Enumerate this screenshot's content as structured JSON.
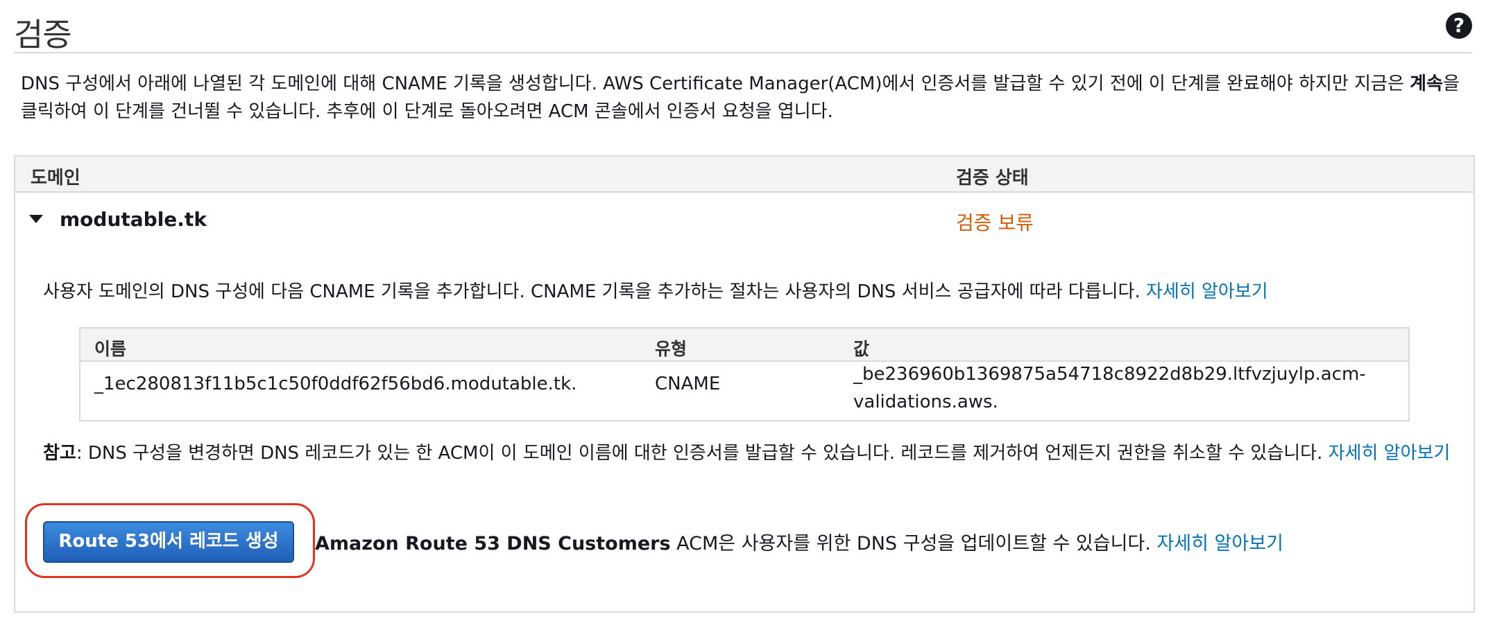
{
  "header": {
    "title": "검증",
    "help_icon": "question-circle-icon"
  },
  "intro": {
    "text_before": "DNS 구성에서 아래에 나열된 각 도메인에 대해 CNAME 기록을 생성합니다. AWS Certificate Manager(ACM)에서 인증서를 발급할 수 있기 전에 이 단계를 완료해야 하지만 지금은 ",
    "bold": "계속",
    "text_after": "을 클릭하여 이 단계를 건너뛸 수 있습니다. 추후에 이 단계로 돌아오려면 ACM 콘솔에서 인증서 요청을 엽니다."
  },
  "table": {
    "columns": {
      "domain": "도메인",
      "status": "검증 상태"
    },
    "row": {
      "domain": "modutable.tk",
      "status": "검증 보류",
      "status_color": "#d45b07",
      "instructions": "사용자 도메인의 DNS 구성에 다음 CNAME 기록을 추가합니다. CNAME 기록을 추가하는 절차는 사용자의 DNS 서비스 공급자에 따라 다릅니다. ",
      "learn_more": "자세히 알아보기",
      "record": {
        "headers": {
          "name": "이름",
          "type": "유형",
          "value": "값"
        },
        "name": "_1ec280813f11b5c1c50f0ddf62f56bd6.modutable.tk.",
        "type": "CNAME",
        "value_line1": "_be236960b1369875a54718c8922d8b29.ltfvzjuylp.acm-",
        "value_line2": "validations.aws."
      },
      "note_label": "참고",
      "note_text": ": DNS 구성을 변경하면 DNS 레코드가 있는 한 ACM이 이 도메인 이름에 대한 인증서를 발급할 수 있습니다. 레코드를 제거하여 언제든지 권한을 취소할 수 있습니다. ",
      "note_link": "자세히 알아보기",
      "route53_button": "Route 53에서 레코드 생성",
      "route53_bold": "Amazon Route 53 DNS Customers",
      "route53_text": " ACM은 사용자를 위한 DNS 구성을 업데이트할 수 있습니다. ",
      "route53_link": "자세히 알아보기"
    }
  },
  "colors": {
    "link": "#0073bb",
    "pending": "#d45b07",
    "button": "#1f5fb7",
    "highlight": "#e0331f"
  }
}
